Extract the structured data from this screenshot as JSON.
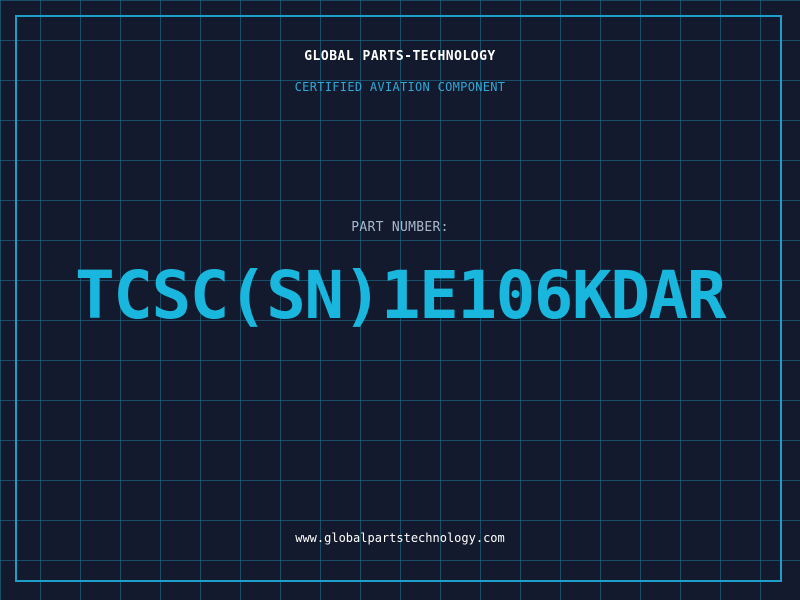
{
  "header": {
    "company": "GLOBAL PARTS-TECHNOLOGY",
    "subtitle": "CERTIFIED AVIATION COMPONENT"
  },
  "part": {
    "label": "PART NUMBER:",
    "number": "TCSC(SN)1E106KDAR"
  },
  "footer": {
    "website": "www.globalpartstechnology.com"
  },
  "colors": {
    "background": "#131a2e",
    "grid": "#1f7696",
    "frame": "#1d9fc9",
    "accent": "#19b6dd",
    "text": "#ffffff"
  }
}
